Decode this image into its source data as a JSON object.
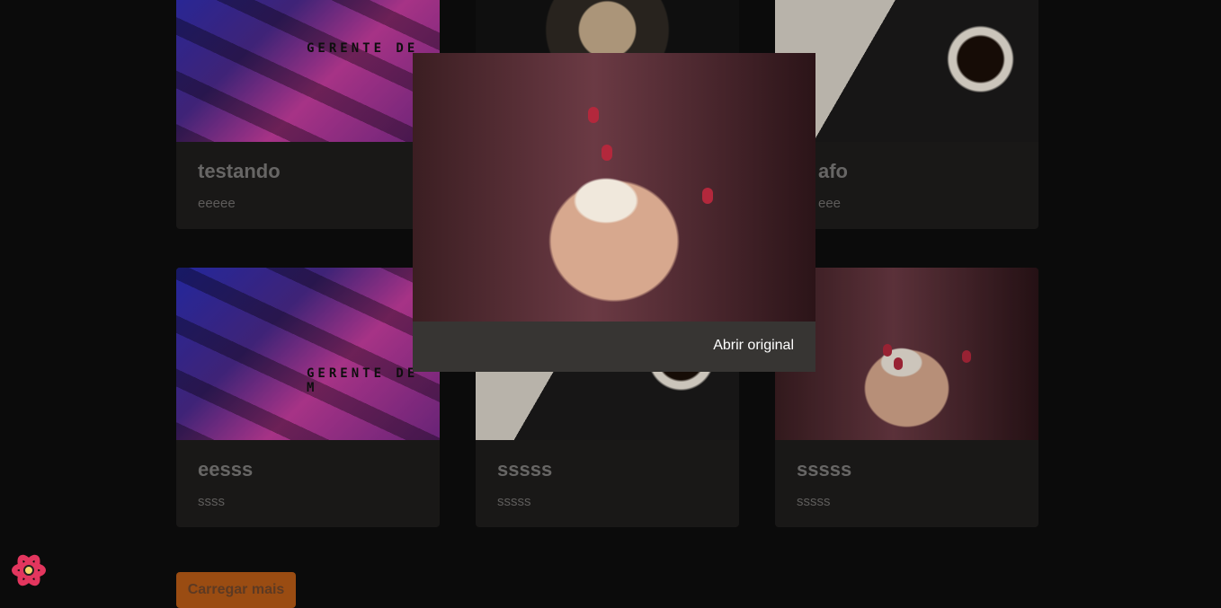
{
  "cards": [
    {
      "title": "testando",
      "description": "eeeee",
      "thumb_icon": "keyboard-image",
      "overlay_text": "GERENTE DE"
    },
    {
      "title": "",
      "description": "",
      "thumb_icon": "portrait-image"
    },
    {
      "title": "afo",
      "description": "eee",
      "thumb_icon": "book-coffee-image"
    },
    {
      "title": "eesss",
      "description": "ssss",
      "thumb_icon": "keyboard-image",
      "overlay_text": "GERENTE DE M"
    },
    {
      "title": "sssss",
      "description": "sssss",
      "thumb_icon": "book-coffee-image"
    },
    {
      "title": "sssss",
      "description": "sssss",
      "thumb_icon": "coffee-cup-hands-image"
    }
  ],
  "modal": {
    "image_icon": "coffee-cup-hands-image",
    "open_original_label": "Abrir original"
  },
  "load_more": {
    "label": "Carregar mais"
  },
  "colors": {
    "background": "#0d0d0d",
    "card": "#1e1d1c",
    "modal_footer": "#373533",
    "load_more": "#9a4c12"
  },
  "dev_tools": {
    "icon": "react-devtools-icon"
  }
}
